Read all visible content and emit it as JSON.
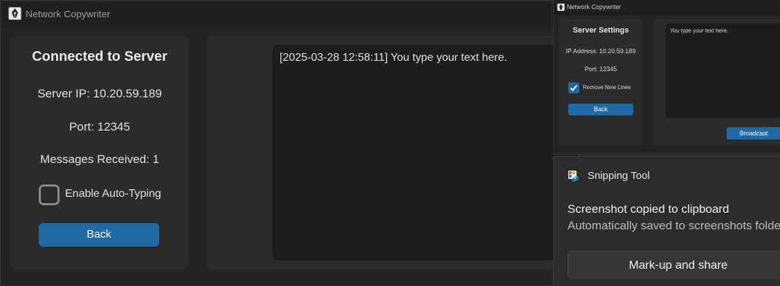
{
  "window": {
    "title": "Network Copywriter",
    "icon": "fountain-pen-icon"
  },
  "left_panel": {
    "title": "Connected to Server",
    "server_ip": "Server IP: 10.20.59.189",
    "port": "Port: 12345",
    "messages": "Messages Received: 1",
    "auto_typing_label": "Enable Auto-Typing",
    "auto_typing_checked": false,
    "back_label": "Back"
  },
  "main": {
    "log_text": "[2025-03-28 12:58:11] You type your text here."
  },
  "thumbnail": {
    "title": "Network Copywriter",
    "settings_title": "Server Settings",
    "ip": "IP Address: 10.20.59.189",
    "port": "Port: 12345",
    "remove_newlines_label": "Remove New Lines",
    "remove_newlines_checked": true,
    "back_label": "Back",
    "input_text": "You type your text here.",
    "broadcast_label": "Broadcast"
  },
  "toast": {
    "app_name": "Snipping Tool",
    "app_icon": "snipping-tool-icon",
    "heading": "Screenshot copied to clipboard",
    "body": "Automatically saved to screenshots folder",
    "action_label": "Mark-up and share"
  },
  "colors": {
    "accent": "#1f6aa5",
    "panel": "#2b2b2b",
    "background": "#242424"
  }
}
